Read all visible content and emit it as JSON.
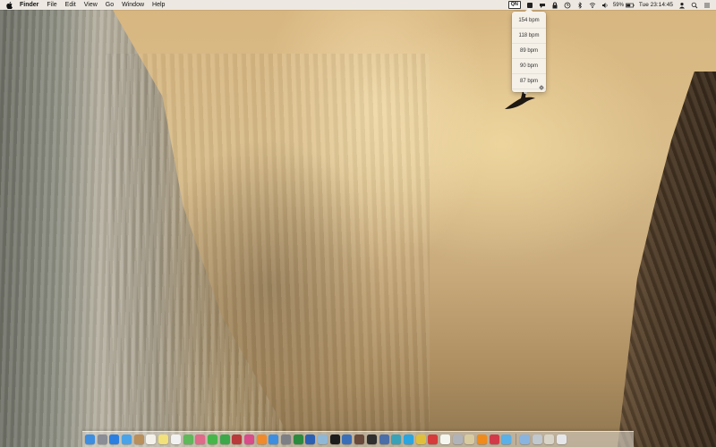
{
  "menubar": {
    "apple_icon": "apple-logo-icon",
    "app_name": "Finder",
    "menus": [
      "File",
      "Edit",
      "View",
      "Go",
      "Window",
      "Help"
    ],
    "status": {
      "qn_label": "QN",
      "battery_percent": "59%",
      "clock": "Tue 23:14:45"
    }
  },
  "dropdown": {
    "items": [
      "154 bpm",
      "118 bpm",
      "89 bpm",
      "90 bpm",
      "87 bpm"
    ],
    "settings_icon": "gear-icon"
  },
  "dock": {
    "icons": [
      {
        "name": "finder-icon",
        "color": "#3d8ee0"
      },
      {
        "name": "launchpad-icon",
        "color": "#8a8d95"
      },
      {
        "name": "safari-icon",
        "color": "#2b7fe0"
      },
      {
        "name": "mail-icon",
        "color": "#4aa3e8"
      },
      {
        "name": "contacts-icon",
        "color": "#b98f5b"
      },
      {
        "name": "calendar-icon",
        "color": "#f4f1ea"
      },
      {
        "name": "notes-icon",
        "color": "#f2e07a"
      },
      {
        "name": "reminders-icon",
        "color": "#f1f1f1"
      },
      {
        "name": "maps-icon",
        "color": "#5fb85a"
      },
      {
        "name": "photos-icon",
        "color": "#e06a8a"
      },
      {
        "name": "messages-icon",
        "color": "#47b64a"
      },
      {
        "name": "facetime-icon",
        "color": "#3ca84a"
      },
      {
        "name": "photobooth-icon",
        "color": "#b83a3a"
      },
      {
        "name": "itunes-icon",
        "color": "#d94b8b"
      },
      {
        "name": "ibooks-icon",
        "color": "#f08a2a"
      },
      {
        "name": "appstore-icon",
        "color": "#3d8ee0"
      },
      {
        "name": "system-preferences-icon",
        "color": "#7d7f86"
      },
      {
        "name": "excel-icon",
        "color": "#2c8a3e"
      },
      {
        "name": "word-icon",
        "color": "#2b5fb3"
      },
      {
        "name": "preview-icon",
        "color": "#8fb7d6"
      },
      {
        "name": "terminal-icon",
        "color": "#1d1d1d"
      },
      {
        "name": "app-icon-blue",
        "color": "#3a6fb8"
      },
      {
        "name": "dictionary-icon",
        "color": "#6a4a3a"
      },
      {
        "name": "activity-monitor-icon",
        "color": "#2f2f2f"
      },
      {
        "name": "network-icon",
        "color": "#4a6ea8"
      },
      {
        "name": "app-icon-teal",
        "color": "#39a2b8"
      },
      {
        "name": "skype-icon",
        "color": "#2aa5e0"
      },
      {
        "name": "chrome-icon",
        "color": "#e0c03a"
      },
      {
        "name": "opera-icon",
        "color": "#d63a3a"
      },
      {
        "name": "textedit-icon",
        "color": "#f5f5f0"
      },
      {
        "name": "disk-utility-icon",
        "color": "#b0b4ba"
      },
      {
        "name": "archive-icon",
        "color": "#d8cba0"
      },
      {
        "name": "vlc-icon",
        "color": "#f08a1a"
      },
      {
        "name": "app-icon-red",
        "color": "#d23a4a"
      },
      {
        "name": "app-icon-sky",
        "color": "#5ab0e8"
      },
      {
        "name": "downloads-stack-icon",
        "color": "#8ab4e0"
      },
      {
        "name": "documents-stack-icon",
        "color": "#c0c8d0"
      },
      {
        "name": "help-icon",
        "color": "#d9d4c8"
      },
      {
        "name": "trash-icon",
        "color": "#e4e6ea"
      }
    ]
  }
}
